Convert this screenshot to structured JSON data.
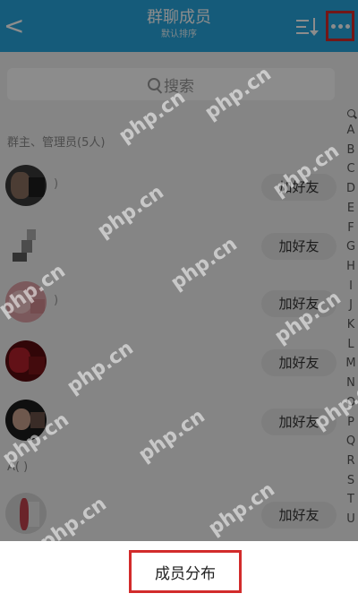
{
  "header": {
    "back_glyph": "<",
    "title": "群聊成员",
    "subtitle": "默认排序"
  },
  "search": {
    "placeholder": "搜索"
  },
  "sections": {
    "owner_admin": "群主、管理员(5人)",
    "a_group": "A(         )"
  },
  "members": [
    {
      "add_label": "加好友",
      "name": ")"
    },
    {
      "add_label": "加好友",
      "name": ""
    },
    {
      "add_label": "加好友",
      "name": ")"
    },
    {
      "add_label": "加好友",
      "name": ""
    },
    {
      "add_label": "加好友",
      "name": ""
    },
    {
      "add_label": "加好友",
      "name": ""
    }
  ],
  "index_letters": [
    "A",
    "B",
    "C",
    "D",
    "E",
    "F",
    "G",
    "H",
    "I",
    "J",
    "K",
    "L",
    "M",
    "N",
    "O",
    "P",
    "Q",
    "R",
    "S",
    "T",
    "U"
  ],
  "watermarks": [
    "php.cn",
    "php.cn",
    "php.cn",
    "php.cn",
    "php.cn",
    "php.cn",
    "php.cn",
    "php.cn",
    "php.cn",
    "php.cn",
    "php.cn",
    "php.cn",
    "php.cn"
  ],
  "action_sheet": {
    "member_distribution": "成员分布"
  },
  "colors": {
    "header": "#27a7df",
    "highlight": "#d22b2b"
  }
}
